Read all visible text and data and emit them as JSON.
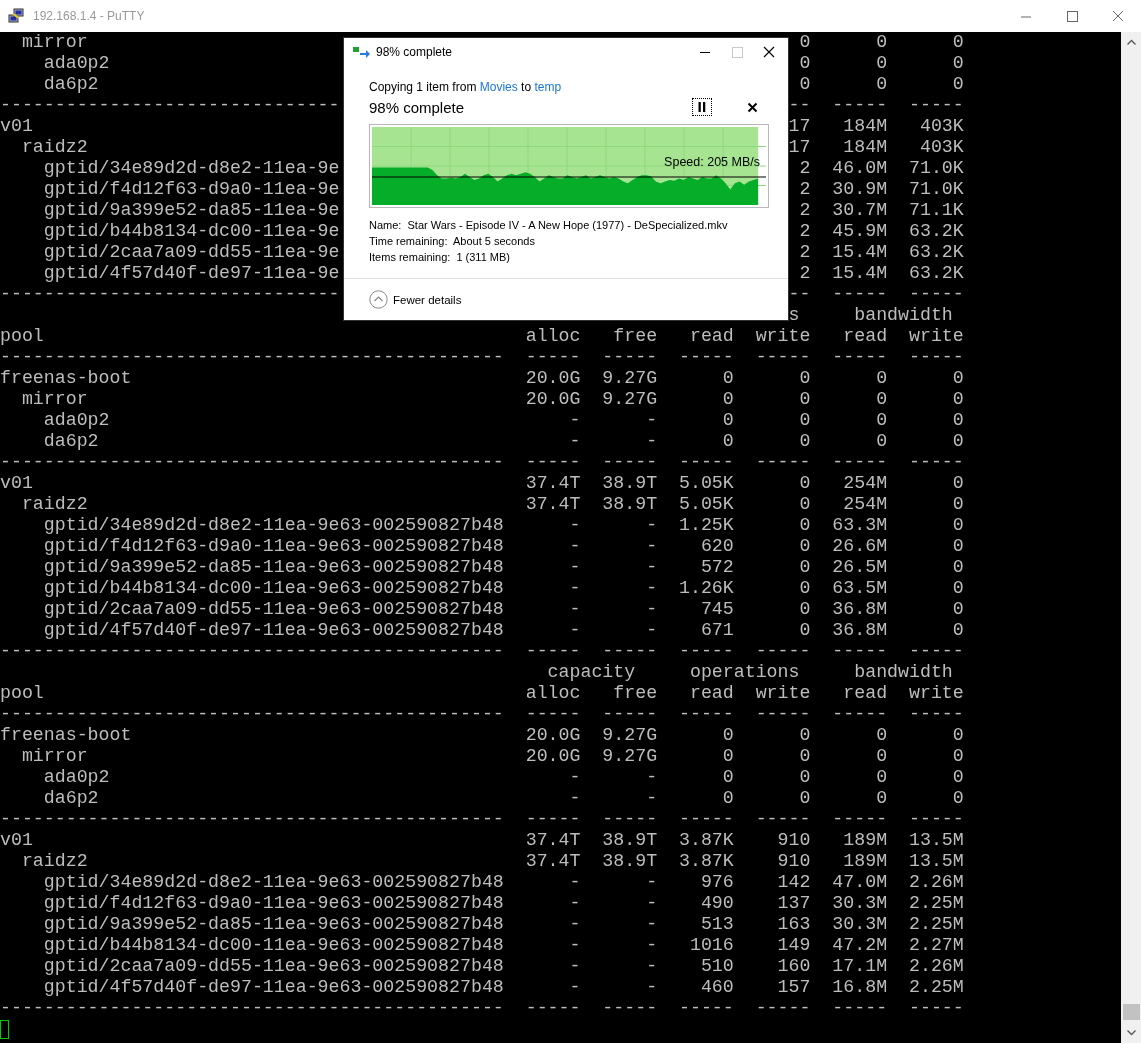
{
  "window": {
    "title": "192.168.1.4 - PuTTY"
  },
  "terminal": {
    "lines": [
      {
        "kind": "clipped",
        "left": "  mirror",
        "right": " 0      0      0"
      },
      {
        "kind": "clipped",
        "left": "    ada0p2",
        "right": " 0      0      0"
      },
      {
        "kind": "clipped",
        "left": "    da6p2",
        "right": " 0      0      0"
      },
      {
        "kind": "clipped",
        "left": "-------------------------------",
        "right": "--  -----  -----"
      },
      {
        "kind": "clipped",
        "left": "v01",
        "right": "17   184M   403K"
      },
      {
        "kind": "clipped",
        "left": "  raidz2",
        "right": "17   184M   403K"
      },
      {
        "kind": "clipped",
        "left": "    gptid/34e89d2d-d8e2-11ea-9e",
        "right": " 2  46.0M  71.0K"
      },
      {
        "kind": "clipped",
        "left": "    gptid/f4d12f63-d9a0-11ea-9e",
        "right": " 2  30.9M  71.0K"
      },
      {
        "kind": "clipped",
        "left": "    gptid/9a399e52-da85-11ea-9e",
        "right": " 2  30.7M  71.1K"
      },
      {
        "kind": "clipped",
        "left": "    gptid/b44b8134-dc00-11ea-9e",
        "right": " 2  45.9M  63.2K"
      },
      {
        "kind": "clipped",
        "left": "    gptid/2caa7a09-dd55-11ea-9e",
        "right": " 2  15.4M  63.2K"
      },
      {
        "kind": "clipped",
        "left": "    gptid/4f57d40f-de97-11ea-9e",
        "right": " 2  15.4M  63.2K"
      },
      {
        "kind": "clipped",
        "left": "-------------------------------",
        "right": "--  -----  -----"
      },
      {
        "kind": "clipped",
        "right": "s     bandwidth"
      },
      {
        "kind": "row",
        "name": "pool",
        "cells": [
          "alloc",
          "free",
          "read",
          "write",
          "read",
          "write"
        ]
      },
      {
        "kind": "row",
        "name": "----------------------------------------------",
        "cells": [
          "-----",
          "-----",
          "-----",
          "-----",
          "-----",
          "-----"
        ]
      },
      {
        "kind": "row",
        "name": "freenas-boot",
        "cells": [
          "20.0G",
          "9.27G",
          "0",
          "0",
          "0",
          "0"
        ]
      },
      {
        "kind": "row",
        "name": "  mirror",
        "cells": [
          "20.0G",
          "9.27G",
          "0",
          "0",
          "0",
          "0"
        ]
      },
      {
        "kind": "row",
        "name": "    ada0p2",
        "cells": [
          "-",
          "-",
          "0",
          "0",
          "0",
          "0"
        ]
      },
      {
        "kind": "row",
        "name": "    da6p2",
        "cells": [
          "-",
          "-",
          "0",
          "0",
          "0",
          "0"
        ]
      },
      {
        "kind": "row",
        "name": "----------------------------------------------",
        "cells": [
          "-----",
          "-----",
          "-----",
          "-----",
          "-----",
          "-----"
        ]
      },
      {
        "kind": "row",
        "name": "v01",
        "cells": [
          "37.4T",
          "38.9T",
          "5.05K",
          "0",
          "254M",
          "0"
        ]
      },
      {
        "kind": "row",
        "name": "  raidz2",
        "cells": [
          "37.4T",
          "38.9T",
          "5.05K",
          "0",
          "254M",
          "0"
        ]
      },
      {
        "kind": "row",
        "name": "    gptid/34e89d2d-d8e2-11ea-9e63-002590827b48",
        "cells": [
          "-",
          "-",
          "1.25K",
          "0",
          "63.3M",
          "0"
        ]
      },
      {
        "kind": "row",
        "name": "    gptid/f4d12f63-d9a0-11ea-9e63-002590827b48",
        "cells": [
          "-",
          "-",
          "620",
          "0",
          "26.6M",
          "0"
        ]
      },
      {
        "kind": "row",
        "name": "    gptid/9a399e52-da85-11ea-9e63-002590827b48",
        "cells": [
          "-",
          "-",
          "572",
          "0",
          "26.5M",
          "0"
        ]
      },
      {
        "kind": "row",
        "name": "    gptid/b44b8134-dc00-11ea-9e63-002590827b48",
        "cells": [
          "-",
          "-",
          "1.26K",
          "0",
          "63.5M",
          "0"
        ]
      },
      {
        "kind": "row",
        "name": "    gptid/2caa7a09-dd55-11ea-9e63-002590827b48",
        "cells": [
          "-",
          "-",
          "745",
          "0",
          "36.8M",
          "0"
        ]
      },
      {
        "kind": "row",
        "name": "    gptid/4f57d40f-de97-11ea-9e63-002590827b48",
        "cells": [
          "-",
          "-",
          "671",
          "0",
          "36.8M",
          "0"
        ]
      },
      {
        "kind": "row",
        "name": "----------------------------------------------",
        "cells": [
          "-----",
          "-----",
          "-----",
          "-----",
          "-----",
          "-----"
        ]
      },
      {
        "kind": "header",
        "text": "                                                  capacity     operations     bandwidth"
      },
      {
        "kind": "row",
        "name": "pool",
        "cells": [
          "alloc",
          "free",
          "read",
          "write",
          "read",
          "write"
        ]
      },
      {
        "kind": "row",
        "name": "----------------------------------------------",
        "cells": [
          "-----",
          "-----",
          "-----",
          "-----",
          "-----",
          "-----"
        ]
      },
      {
        "kind": "row",
        "name": "freenas-boot",
        "cells": [
          "20.0G",
          "9.27G",
          "0",
          "0",
          "0",
          "0"
        ]
      },
      {
        "kind": "row",
        "name": "  mirror",
        "cells": [
          "20.0G",
          "9.27G",
          "0",
          "0",
          "0",
          "0"
        ]
      },
      {
        "kind": "row",
        "name": "    ada0p2",
        "cells": [
          "-",
          "-",
          "0",
          "0",
          "0",
          "0"
        ]
      },
      {
        "kind": "row",
        "name": "    da6p2",
        "cells": [
          "-",
          "-",
          "0",
          "0",
          "0",
          "0"
        ]
      },
      {
        "kind": "row",
        "name": "----------------------------------------------",
        "cells": [
          "-----",
          "-----",
          "-----",
          "-----",
          "-----",
          "-----"
        ]
      },
      {
        "kind": "row",
        "name": "v01",
        "cells": [
          "37.4T",
          "38.9T",
          "3.87K",
          "910",
          "189M",
          "13.5M"
        ]
      },
      {
        "kind": "row",
        "name": "  raidz2",
        "cells": [
          "37.4T",
          "38.9T",
          "3.87K",
          "910",
          "189M",
          "13.5M"
        ]
      },
      {
        "kind": "row",
        "name": "    gptid/34e89d2d-d8e2-11ea-9e63-002590827b48",
        "cells": [
          "-",
          "-",
          "976",
          "142",
          "47.0M",
          "2.26M"
        ]
      },
      {
        "kind": "row",
        "name": "    gptid/f4d12f63-d9a0-11ea-9e63-002590827b48",
        "cells": [
          "-",
          "-",
          "490",
          "137",
          "30.3M",
          "2.25M"
        ]
      },
      {
        "kind": "row",
        "name": "    gptid/9a399e52-da85-11ea-9e63-002590827b48",
        "cells": [
          "-",
          "-",
          "513",
          "163",
          "30.3M",
          "2.25M"
        ]
      },
      {
        "kind": "row",
        "name": "    gptid/b44b8134-dc00-11ea-9e63-002590827b48",
        "cells": [
          "-",
          "-",
          "1016",
          "149",
          "47.2M",
          "2.27M"
        ]
      },
      {
        "kind": "row",
        "name": "    gptid/2caa7a09-dd55-11ea-9e63-002590827b48",
        "cells": [
          "-",
          "-",
          "510",
          "160",
          "17.1M",
          "2.26M"
        ]
      },
      {
        "kind": "row",
        "name": "    gptid/4f57d40f-de97-11ea-9e63-002590827b48",
        "cells": [
          "-",
          "-",
          "460",
          "157",
          "16.8M",
          "2.25M"
        ]
      },
      {
        "kind": "row",
        "name": "----------------------------------------------",
        "cells": [
          "-----",
          "-----",
          "-----",
          "-----",
          "-----",
          "-----"
        ]
      }
    ]
  },
  "dialog": {
    "title": "98% complete",
    "copying": {
      "prefix": "Copying 1 item from",
      "source": "Movies",
      "middle": "to",
      "destination": "temp"
    },
    "heading": "98% complete",
    "progress": {
      "level": 0.98,
      "speed": "Speed: 205 MB/s"
    },
    "details": [
      {
        "label": "Name:",
        "value": "Star Wars - Episode IV - A New Hope (1977) - DeSpecialized.mkv"
      },
      {
        "label": "Time remaining:",
        "value": "About 5 seconds"
      },
      {
        "label": "Items remaining:",
        "value": "1 (311 MB)"
      }
    ],
    "toggle": "Fewer details"
  }
}
